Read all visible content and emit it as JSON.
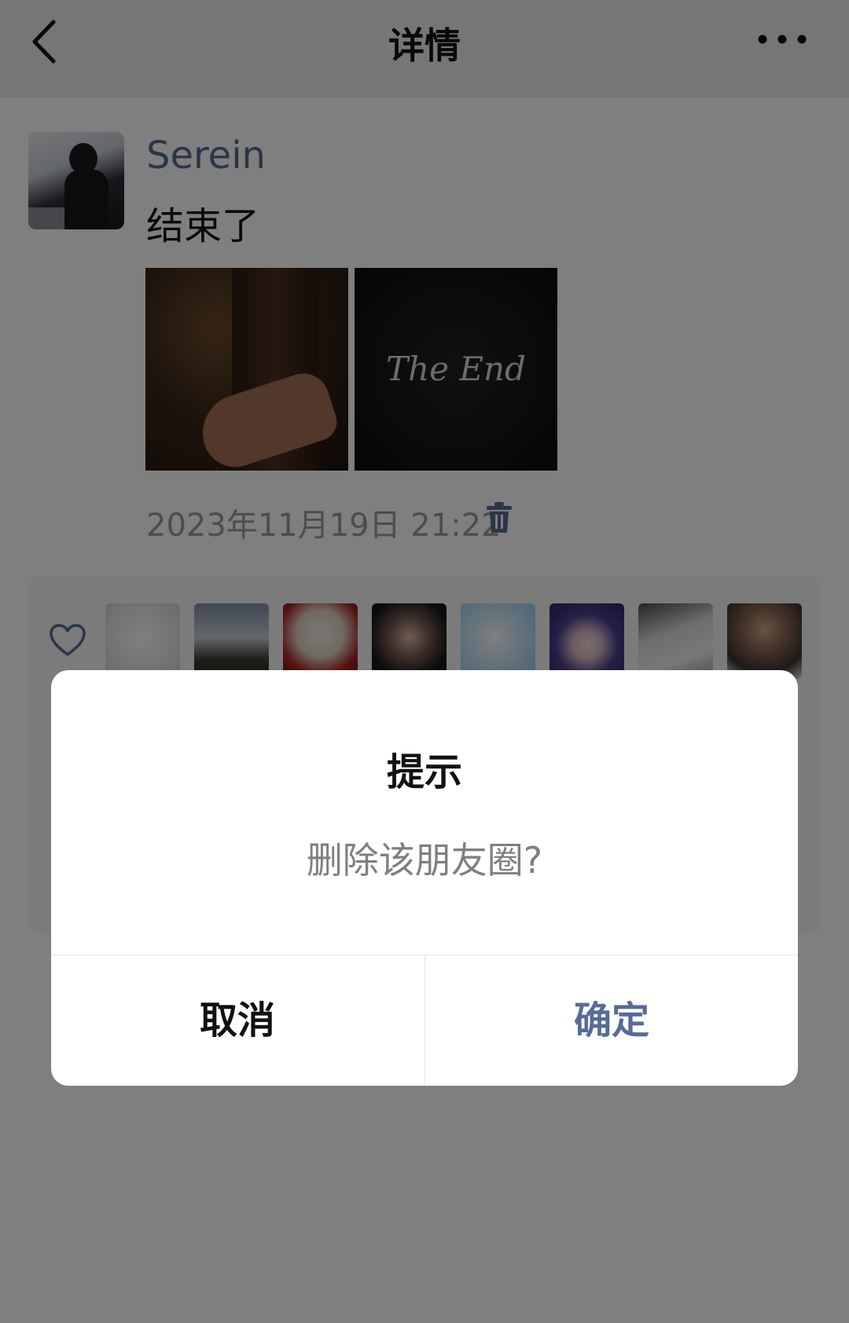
{
  "header": {
    "title": "详情"
  },
  "post": {
    "username": "Serein",
    "text": "结束了",
    "timestamp": "2023年11月19日 21:22",
    "photos": [
      {
        "label": ""
      },
      {
        "label": "The End"
      }
    ]
  },
  "dialog": {
    "title": "提示",
    "message": "删除该朋友圈?",
    "cancel_label": "取消",
    "confirm_label": "确定"
  },
  "colors": {
    "accent": "#576b95",
    "overlay": "rgba(0,0,0,0.5)",
    "timestamp": "#9a9a9a"
  }
}
